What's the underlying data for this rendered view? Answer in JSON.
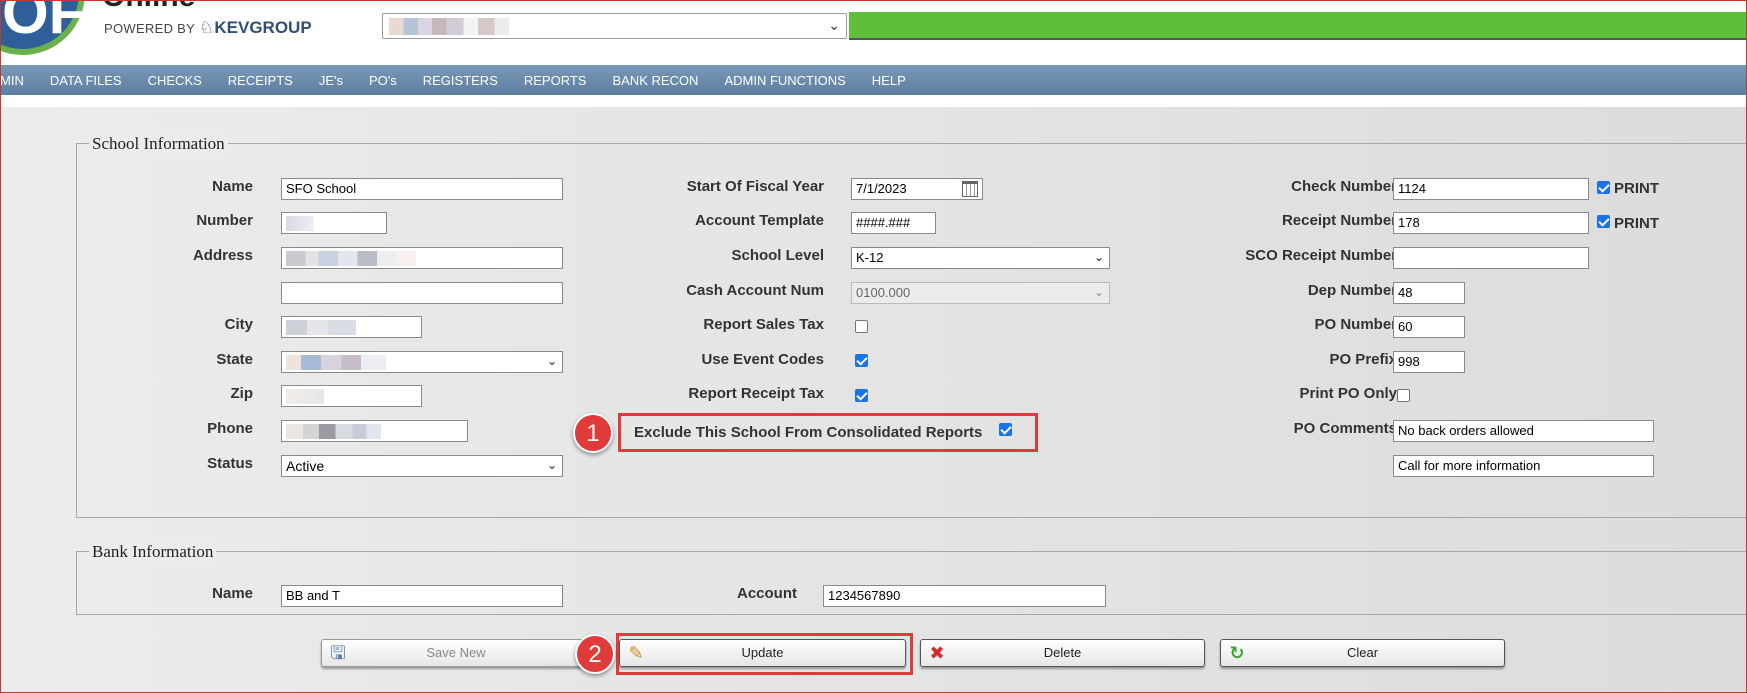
{
  "header": {
    "app_title": "Online",
    "powered_by": "POWERED BY",
    "brand": "KEVGROUP",
    "logo_letters": "OF"
  },
  "nav": [
    "MIN",
    "DATA FILES",
    "CHECKS",
    "RECEIPTS",
    "JE's",
    "PO's",
    "REGISTERS",
    "REPORTS",
    "BANK RECON",
    "ADMIN FUNCTIONS",
    "HELP"
  ],
  "school_info": {
    "legend": "School Information",
    "name_label": "Name",
    "name_value": "SFO School",
    "number_label": "Number",
    "address_label": "Address",
    "city_label": "City",
    "state_label": "State",
    "zip_label": "Zip",
    "phone_label": "Phone",
    "status_label": "Status",
    "status_value": "Active",
    "fiscal_label": "Start Of Fiscal Year",
    "fiscal_value": "7/1/2023",
    "template_label": "Account Template",
    "template_value": "####.###",
    "level_label": "School Level",
    "level_value": "K-12",
    "cash_label": "Cash Account Num",
    "cash_value": "0100.000",
    "sales_tax_label": "Report Sales Tax",
    "event_codes_label": "Use Event Codes",
    "receipt_tax_label": "Report Receipt Tax",
    "exclude_label": "Exclude This School From Consolidated Reports",
    "check_number_label": "Check Number",
    "check_number_value": "1124",
    "print_label": "PRINT",
    "receipt_number_label": "Receipt Number",
    "receipt_number_value": "178",
    "sco_label": "SCO Receipt Number",
    "sco_value": "",
    "dep_label": "Dep Number",
    "dep_value": "48",
    "po_number_label": "PO Number",
    "po_number_value": "60",
    "po_prefix_label": "PO Prefix",
    "po_prefix_value": "998",
    "print_po_label": "Print PO Only",
    "po_comments_label": "PO Comments",
    "po_comment_1": "No back orders allowed",
    "po_comment_2": "Call for more information"
  },
  "checkbox_states": {
    "check_print": true,
    "receipt_print": true,
    "sales_tax": false,
    "event_codes": true,
    "receipt_tax": true,
    "exclude": true,
    "print_po_only": false
  },
  "bank_info": {
    "legend": "Bank Information",
    "name_label": "Name",
    "name_value": "BB and T",
    "account_label": "Account",
    "account_value": "1234567890"
  },
  "buttons": {
    "save_new": "Save New",
    "update": "Update",
    "delete": "Delete",
    "clear": "Clear"
  },
  "annotations": {
    "badge1": "1",
    "badge2": "2"
  },
  "colors": {
    "nav": "#6a8aab",
    "accent_green": "#5fbf3a",
    "highlight": "#e03a3a"
  }
}
